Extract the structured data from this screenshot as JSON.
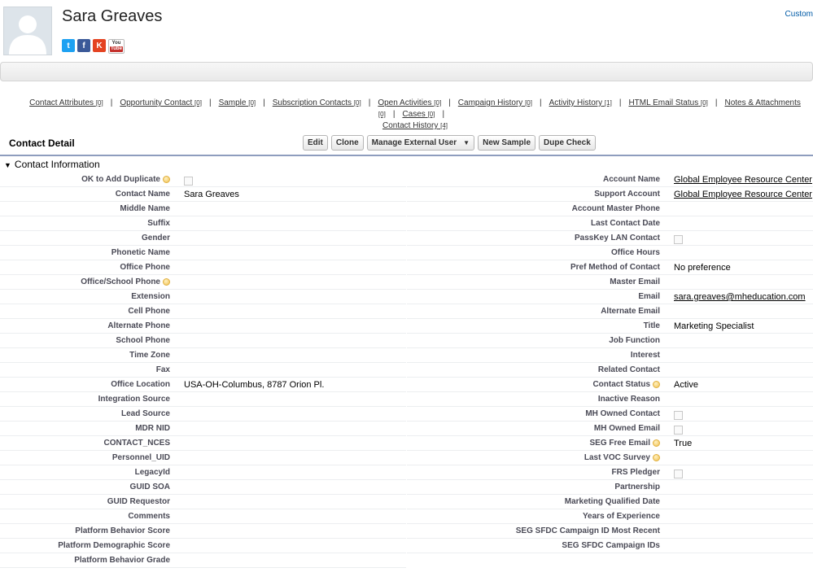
{
  "contact": {
    "name": "Sara Greaves",
    "top_right_link": "Custom"
  },
  "social": {
    "twitter": "t",
    "facebook": "f",
    "klout": "K",
    "youtube_top": "You",
    "youtube_bottom": "Tube"
  },
  "related_links": [
    {
      "label": "Contact Attributes",
      "count": "[0]"
    },
    {
      "label": "Opportunity Contact",
      "count": "[0]"
    },
    {
      "label": "Sample",
      "count": "[0]"
    },
    {
      "label": "Subscription Contacts",
      "count": "[0]"
    },
    {
      "label": "Open Activities",
      "count": "[0]"
    },
    {
      "label": "Campaign History",
      "count": "[0]"
    },
    {
      "label": "Activity History",
      "count": "[1]"
    },
    {
      "label": "HTML Email Status",
      "count": "[0]"
    },
    {
      "label": "Notes & Attachments",
      "count": "[0]"
    },
    {
      "label": "Cases",
      "count": "[0]"
    },
    {
      "label": "Contact History",
      "count": "[4]"
    }
  ],
  "detail": {
    "title": "Contact Detail",
    "buttons": {
      "edit": "Edit",
      "clone": "Clone",
      "manage_external_user": "Manage External User",
      "new_sample": "New Sample",
      "dupe_check": "Dupe Check"
    },
    "section_title": "Contact Information"
  },
  "left_fields": [
    {
      "label": "OK to Add Duplicate",
      "value": "",
      "help": true,
      "checkbox": true
    },
    {
      "label": "Contact Name",
      "value": "Sara Greaves"
    },
    {
      "label": "Middle Name",
      "value": ""
    },
    {
      "label": "Suffix",
      "value": ""
    },
    {
      "label": "Gender",
      "value": ""
    },
    {
      "label": "Phonetic Name",
      "value": ""
    },
    {
      "label": "Office Phone",
      "value": ""
    },
    {
      "label": "Office/School Phone",
      "value": "",
      "help": true
    },
    {
      "label": "Extension",
      "value": ""
    },
    {
      "label": "Cell Phone",
      "value": ""
    },
    {
      "label": "Alternate Phone",
      "value": ""
    },
    {
      "label": "School Phone",
      "value": ""
    },
    {
      "label": "Time Zone",
      "value": ""
    },
    {
      "label": "Fax",
      "value": ""
    },
    {
      "label": "Office Location",
      "value": "USA-OH-Columbus, 8787 Orion Pl."
    },
    {
      "label": "Integration Source",
      "value": ""
    },
    {
      "label": "Lead Source",
      "value": ""
    },
    {
      "label": "MDR NID",
      "value": ""
    },
    {
      "label": "CONTACT_NCES",
      "value": ""
    },
    {
      "label": "Personnel_UID",
      "value": ""
    },
    {
      "label": "LegacyId",
      "value": ""
    },
    {
      "label": "GUID SOA",
      "value": ""
    },
    {
      "label": "GUID Requestor",
      "value": ""
    },
    {
      "label": "Comments",
      "value": ""
    },
    {
      "label": "Platform Behavior Score",
      "value": ""
    },
    {
      "label": "Platform Demographic Score",
      "value": ""
    },
    {
      "label": "Platform Behavior Grade",
      "value": ""
    }
  ],
  "right_fields": [
    {
      "label": "Account Name",
      "value": "Global Employee Resource Center",
      "link": true
    },
    {
      "label": "Support Account",
      "value": "Global Employee Resource Center",
      "link": true
    },
    {
      "label": "Account Master Phone",
      "value": ""
    },
    {
      "label": "Last Contact Date",
      "value": ""
    },
    {
      "label": "PassKey LAN Contact",
      "value": "",
      "checkbox": true
    },
    {
      "label": "Office Hours",
      "value": ""
    },
    {
      "label": "Pref Method of Contact",
      "value": "No preference"
    },
    {
      "label": "Master Email",
      "value": ""
    },
    {
      "label": "Email",
      "value": "sara.greaves@mheducation.com",
      "link": true
    },
    {
      "label": "Alternate Email",
      "value": ""
    },
    {
      "label": "Title",
      "value": "Marketing Specialist"
    },
    {
      "label": "Job Function",
      "value": ""
    },
    {
      "label": "Interest",
      "value": ""
    },
    {
      "label": "Related Contact",
      "value": ""
    },
    {
      "label": "Contact Status",
      "value": "Active",
      "help": true
    },
    {
      "label": "Inactive Reason",
      "value": ""
    },
    {
      "label": "MH Owned Contact",
      "value": "",
      "checkbox": true
    },
    {
      "label": "MH Owned Email",
      "value": "",
      "checkbox": true
    },
    {
      "label": "SEG Free Email",
      "value": "True",
      "help": true
    },
    {
      "label": "Last VOC Survey",
      "value": "",
      "help": true
    },
    {
      "label": "FRS Pledger",
      "value": "",
      "checkbox": true
    },
    {
      "label": "Partnership",
      "value": ""
    },
    {
      "label": "Marketing Qualified Date",
      "value": ""
    },
    {
      "label": "Years of Experience",
      "value": ""
    },
    {
      "label": "SEG SFDC Campaign ID Most Recent",
      "value": ""
    },
    {
      "label": "SEG SFDC Campaign IDs",
      "value": ""
    }
  ]
}
